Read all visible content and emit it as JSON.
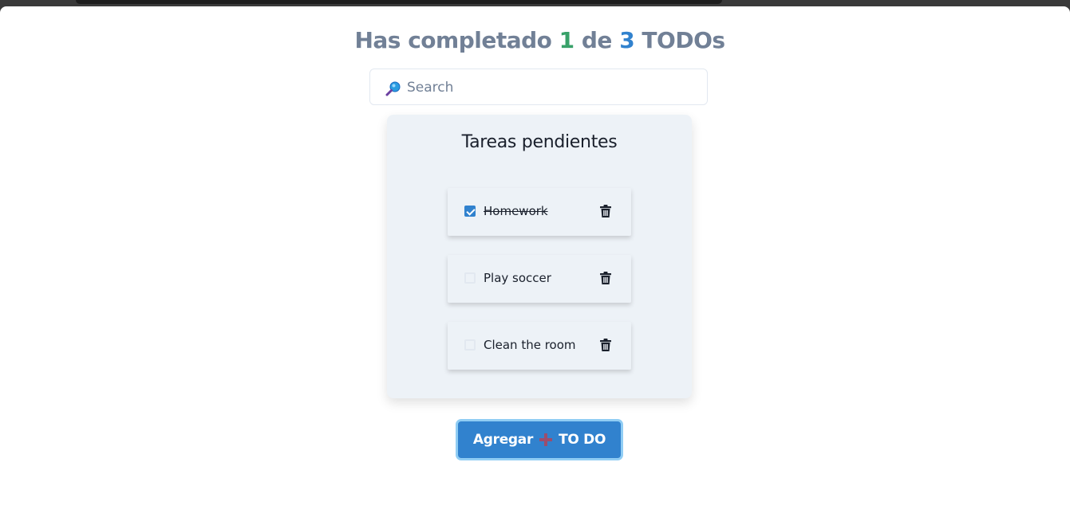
{
  "header": {
    "prefix": "Has completado",
    "completed": "1",
    "middle": "de",
    "total": "3",
    "suffix": "TODOs"
  },
  "search": {
    "placeholder": "Search",
    "value": "",
    "icon": "magnifying-glass-icon"
  },
  "panel": {
    "title": "Tareas pendientes"
  },
  "todos": [
    {
      "text": "Homework",
      "completed": true
    },
    {
      "text": "Play soccer",
      "completed": false
    },
    {
      "text": "Clean the room",
      "completed": false
    }
  ],
  "add_button": {
    "label_before": "Agregar",
    "label_after": "TO DO",
    "icon": "plus-icon"
  },
  "colors": {
    "completed_count": "#38a169",
    "total_count": "#3182ce",
    "headline": "#718096",
    "button": "#3182ce",
    "panel": "#edf2f7"
  }
}
